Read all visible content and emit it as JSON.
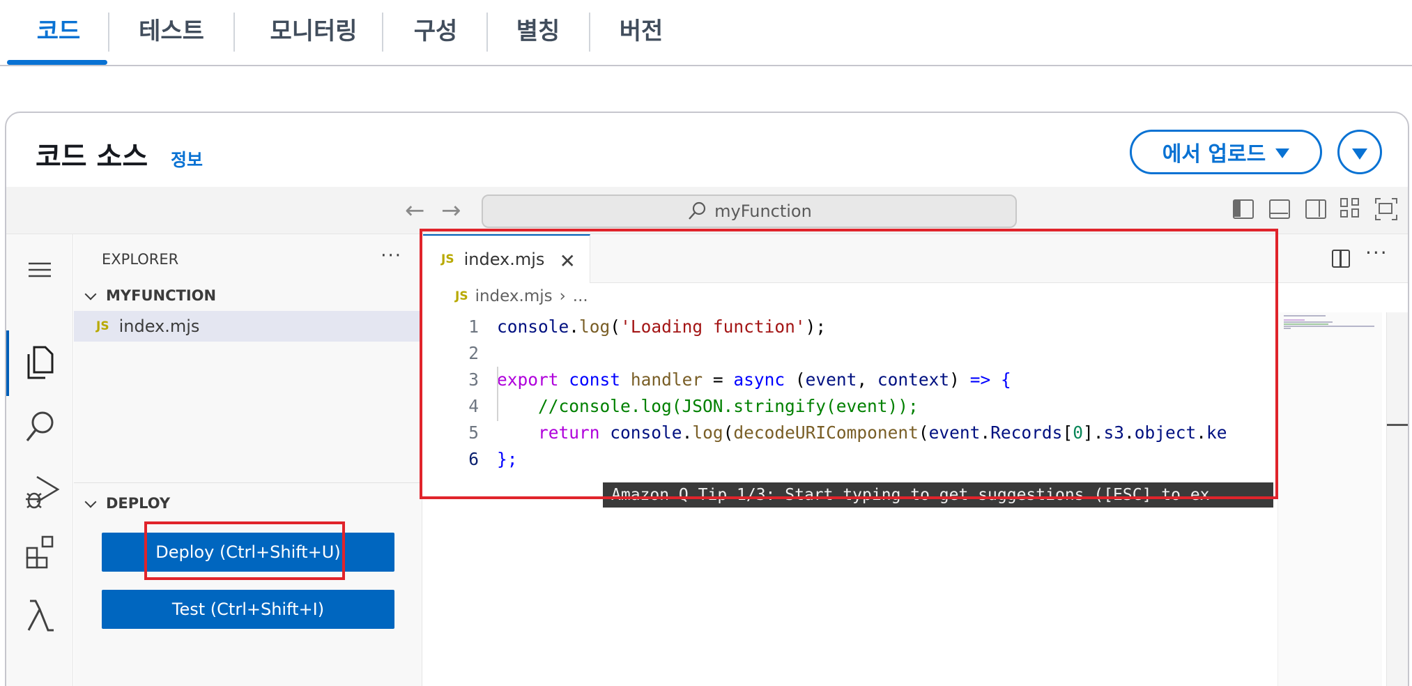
{
  "tabs": [
    {
      "label": "코드",
      "active": true
    },
    {
      "label": "테스트",
      "active": false
    },
    {
      "label": "모니터링",
      "active": false
    },
    {
      "label": "구성",
      "active": false
    },
    {
      "label": "별칭",
      "active": false
    },
    {
      "label": "버전",
      "active": false
    }
  ],
  "card": {
    "title": "코드 소스",
    "info_link": "정보",
    "upload_button": "에서 업로드"
  },
  "ide": {
    "command_center": "myFunction",
    "explorer": {
      "title": "EXPLORER",
      "more": "···",
      "folder": "MYFUNCTION",
      "file": {
        "badge": "JS",
        "name": "index.mjs"
      }
    },
    "deploy_section": {
      "title": "DEPLOY",
      "deploy_button": "Deploy (Ctrl+Shift+U)",
      "test_button": "Test (Ctrl+Shift+I)"
    },
    "editor": {
      "tab": {
        "badge": "JS",
        "name": "index.mjs",
        "close": "✕"
      },
      "breadcrumb": {
        "file": "index.mjs",
        "separator": "›",
        "rest": "..."
      },
      "more": "···",
      "line_numbers": [
        "1",
        "2",
        "3",
        "4",
        "5",
        "6"
      ],
      "current_line": 6,
      "lines": [
        {
          "tokens": [
            {
              "t": "console",
              "c": "var"
            },
            {
              "t": ".",
              "c": "pl"
            },
            {
              "t": "log",
              "c": "fn"
            },
            {
              "t": "(",
              "c": "pl"
            },
            {
              "t": "'Loading function'",
              "c": "str"
            },
            {
              "t": ");",
              "c": "pl"
            }
          ]
        },
        {
          "tokens": []
        },
        {
          "tokens": [
            {
              "t": "export",
              "c": "kwc"
            },
            {
              "t": " ",
              "c": "pl"
            },
            {
              "t": "const",
              "c": "kw"
            },
            {
              "t": " ",
              "c": "pl"
            },
            {
              "t": "handler",
              "c": "fn"
            },
            {
              "t": " = ",
              "c": "pl"
            },
            {
              "t": "async",
              "c": "kw"
            },
            {
              "t": " (",
              "c": "pl"
            },
            {
              "t": "event",
              "c": "var"
            },
            {
              "t": ", ",
              "c": "pl"
            },
            {
              "t": "context",
              "c": "var"
            },
            {
              "t": ") ",
              "c": "pl"
            },
            {
              "t": "=>",
              "c": "kw"
            },
            {
              "t": " {",
              "c": "kw"
            }
          ]
        },
        {
          "tokens": [
            {
              "t": "    ",
              "c": "pl"
            },
            {
              "t": "//console.log(JSON.stringify(event));",
              "c": "cmt"
            }
          ]
        },
        {
          "tokens": [
            {
              "t": "    ",
              "c": "pl"
            },
            {
              "t": "return",
              "c": "kwc"
            },
            {
              "t": " ",
              "c": "pl"
            },
            {
              "t": "console",
              "c": "var"
            },
            {
              "t": ".",
              "c": "pl"
            },
            {
              "t": "log",
              "c": "fn"
            },
            {
              "t": "(",
              "c": "pl"
            },
            {
              "t": "decodeURIComponent",
              "c": "fn"
            },
            {
              "t": "(",
              "c": "pl"
            },
            {
              "t": "event",
              "c": "var"
            },
            {
              "t": ".",
              "c": "pl"
            },
            {
              "t": "Records",
              "c": "var"
            },
            {
              "t": "[",
              "c": "pl"
            },
            {
              "t": "0",
              "c": "num"
            },
            {
              "t": "].",
              "c": "pl"
            },
            {
              "t": "s3",
              "c": "var"
            },
            {
              "t": ".",
              "c": "pl"
            },
            {
              "t": "object",
              "c": "var"
            },
            {
              "t": ".",
              "c": "pl"
            },
            {
              "t": "ke",
              "c": "var"
            }
          ]
        },
        {
          "tokens": [
            {
              "t": "};",
              "c": "kw"
            }
          ]
        }
      ],
      "amazon_q_tip": "Amazon Q Tip 1/3: Start typing to get suggestions ([ESC] to ex"
    }
  },
  "colors": {
    "accent": "#0972d3",
    "button_primary": "#0066bf",
    "highlight_box": "#e0242b"
  }
}
